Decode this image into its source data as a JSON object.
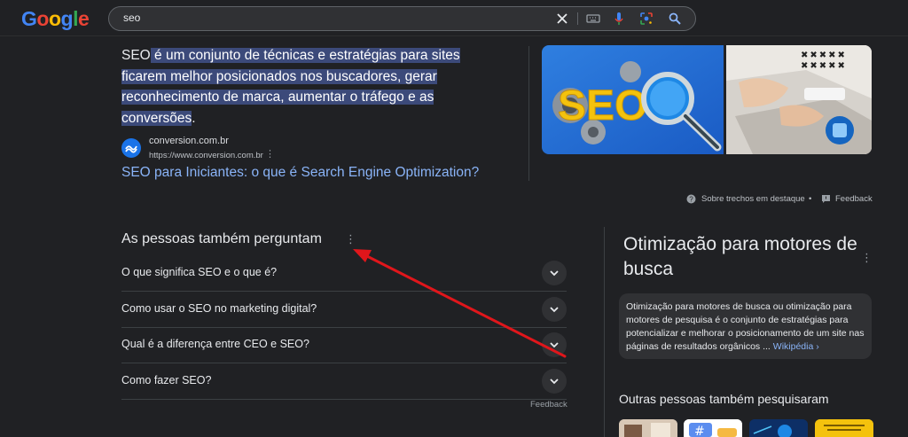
{
  "header": {
    "logo": "Google",
    "search_value": "seo"
  },
  "snippet": {
    "lead": "SEO",
    "highlight_parts": [
      " é um conjunto de técnicas e estratégias para sites",
      "ficarem melhor posicionados nos buscadores, gerar",
      "reconhecimento de marca, aumentar o tráfego e as",
      "conversões"
    ],
    "tail": ".",
    "source_name": "conversion.com.br",
    "source_url": "https://www.conversion.com.br",
    "source_menu": "⋮",
    "link_text": "SEO para Iniciantes: o que é Search Engine Optimization?",
    "image1_text": "SEO",
    "about_label": "Sobre trechos em destaque",
    "dot": "•",
    "feedback_label": "Feedback"
  },
  "paa": {
    "title": "As pessoas também perguntam",
    "menu": "⋮",
    "questions": [
      "O que significa SEO e o que é?",
      "Como usar o SEO no marketing digital?",
      "Qual é a diferença entre CEO e SEO?",
      "Como fazer SEO?"
    ],
    "feedback_label": "Feedback"
  },
  "knowledge_panel": {
    "title": "Otimização para motores de busca",
    "menu": "⋮",
    "description": "Otimização para motores de busca ou otimização para motores de pesquisa é o conjunto de estratégias para potencializar e melhorar o posicionamento de um site nas páginas de resultados orgânicos ...",
    "wiki_link": "Wikipédia ›",
    "others_title": "Outras pessoas também pesquisaram"
  },
  "colors": {
    "background": "#202124",
    "link": "#8ab4f8",
    "arrow": "#e0161b"
  }
}
